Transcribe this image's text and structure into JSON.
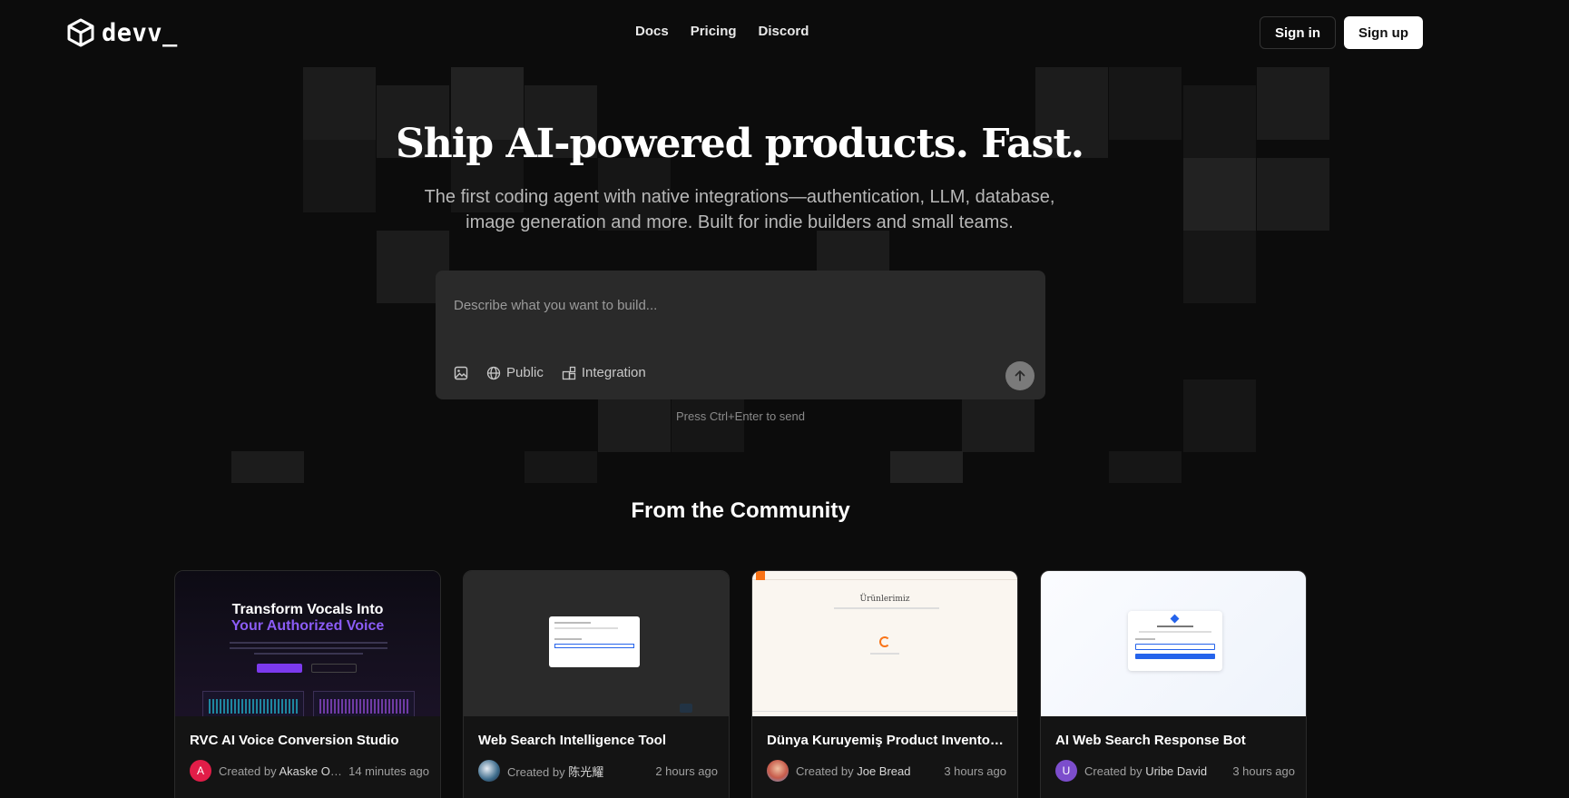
{
  "header": {
    "logo_text": "devv_",
    "nav": [
      "Docs",
      "Pricing",
      "Discord"
    ],
    "sign_in": "Sign in",
    "sign_up": "Sign up"
  },
  "hero": {
    "title": "Ship AI-powered products. Fast.",
    "subtitle_line1": "The first coding agent with native integrations—authentication, LLM, database,",
    "subtitle_line2": "image generation and more. Built for indie builders and small teams."
  },
  "prompt": {
    "placeholder": "Describe what you want to build...",
    "tools": {
      "image_icon": "image-upload-icon",
      "visibility_label": "Public",
      "integration_label": "Integration"
    },
    "hint": "Press Ctrl+Enter to send"
  },
  "community": {
    "title": "From the Community",
    "cards": [
      {
        "title": "RVC AI Voice Conversion Studio",
        "avatar_letter": "A",
        "avatar_color": "#e11d48",
        "created_prefix": "Created by",
        "author": "Akaske Of...",
        "time": "14 minutes ago",
        "thumb": {
          "heading1": "Transform Vocals Into",
          "heading2": "Your Authorized Voice"
        }
      },
      {
        "title": "Web Search Intelligence Tool",
        "avatar_letter": "",
        "avatar_color": "#3b6a8a",
        "created_prefix": "Created by",
        "author": "陈光耀",
        "time": "2 hours ago"
      },
      {
        "title": "Dünya Kuruyemiş Product Inventory...",
        "avatar_letter": "",
        "avatar_color": "#c65a4a",
        "created_prefix": "Created by",
        "author": "Joe Bread",
        "time": "3 hours ago",
        "thumb": {
          "heading": "Ürünlerimiz"
        }
      },
      {
        "title": "AI Web Search Response Bot",
        "avatar_letter": "U",
        "avatar_color": "#7c4dcc",
        "created_prefix": "Created by",
        "author": "Uribe David",
        "time": "3 hours ago"
      }
    ]
  },
  "colors": {
    "background": "#0c0c0c",
    "prompt_bg": "#2a2a2a",
    "accent_purple": "#8b5cf6"
  }
}
